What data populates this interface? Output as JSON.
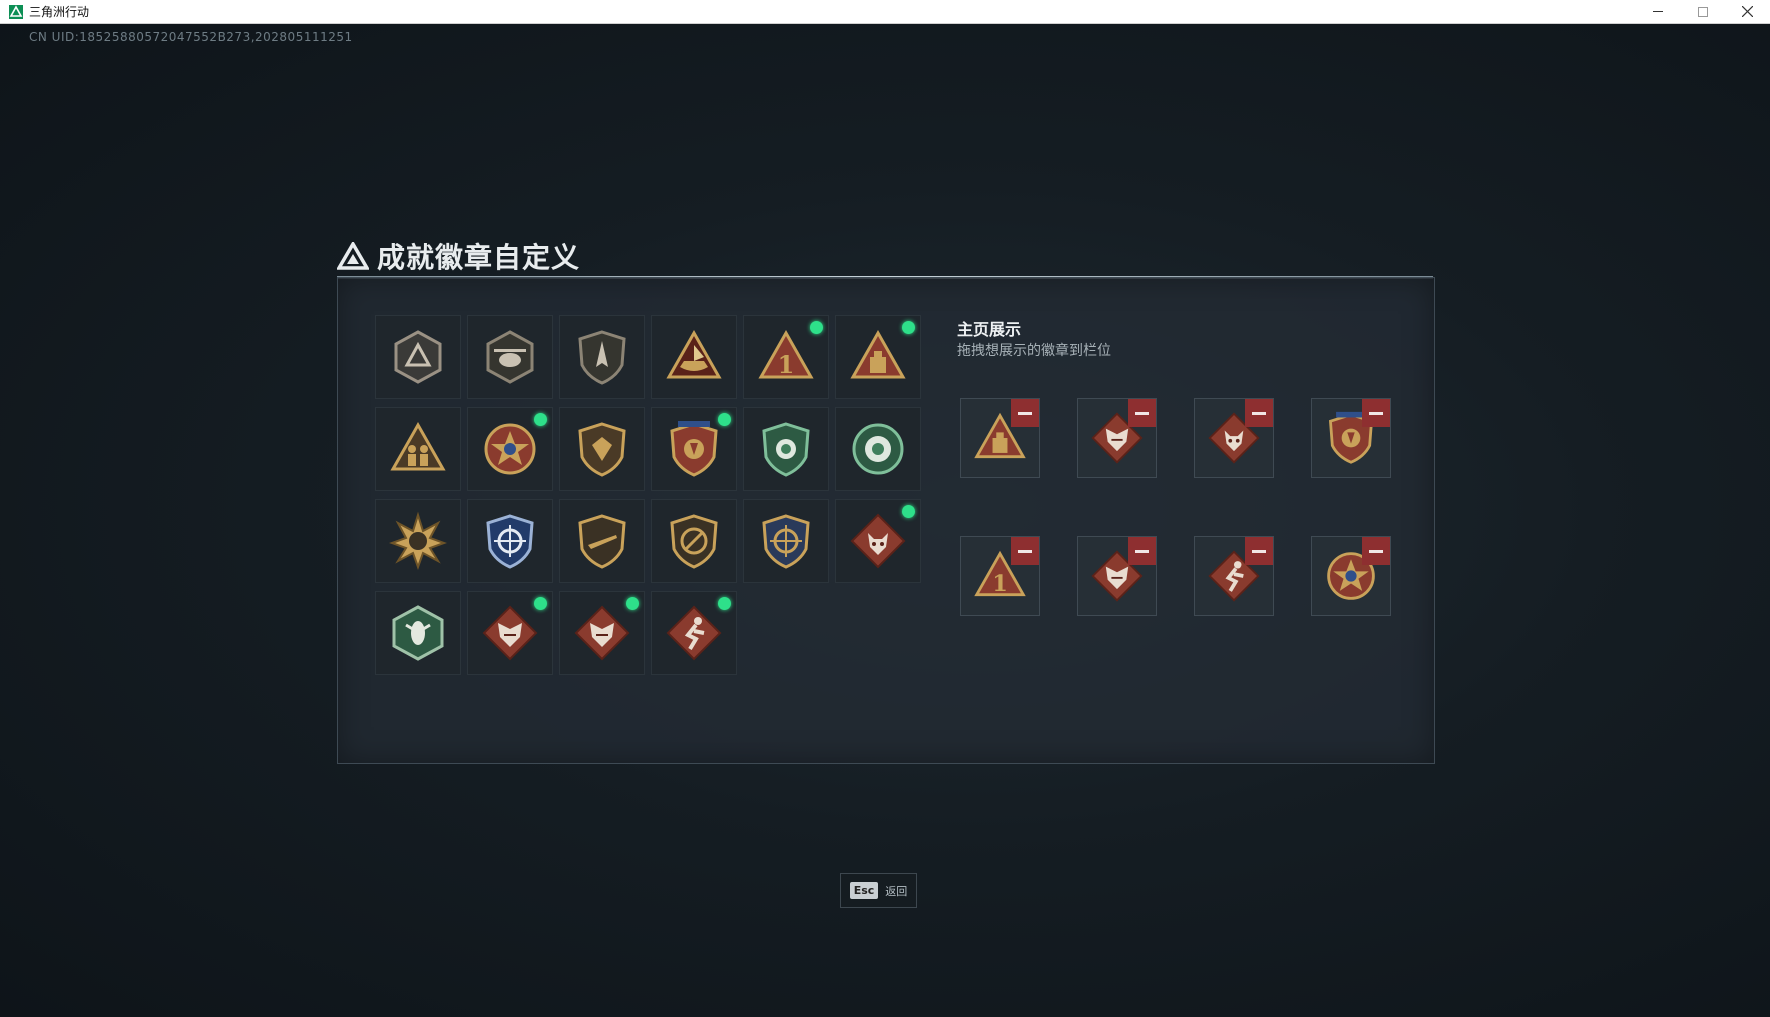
{
  "window": {
    "title": "三角洲行动",
    "icon": "delta-logo-icon"
  },
  "uid_text": "CN UID:18525880572047552B273,202805111251",
  "panel": {
    "title": "成就徽章自定义",
    "showcase_title": "主页展示",
    "showcase_hint": "拖拽想展示的徽章到栏位"
  },
  "badges": [
    {
      "icon": "delta-shield-badge-icon",
      "new": false
    },
    {
      "icon": "helicopter-badge-icon",
      "new": false
    },
    {
      "icon": "jet-shield-badge-icon",
      "new": false
    },
    {
      "icon": "ship-triangle-badge-icon",
      "new": false
    },
    {
      "icon": "number-one-triangle-badge-icon",
      "new": true
    },
    {
      "icon": "supply-crate-triangle-badge-icon",
      "new": true
    },
    {
      "icon": "soldiers-triangle-badge-icon",
      "new": false
    },
    {
      "icon": "star-medal-badge-icon",
      "new": true
    },
    {
      "icon": "shield-emblem-badge-icon",
      "new": false
    },
    {
      "icon": "winged-crest-badge-icon",
      "new": true
    },
    {
      "icon": "green-shield-badge-icon",
      "new": false
    },
    {
      "icon": "green-wreath-badge-icon",
      "new": false
    },
    {
      "icon": "sunburst-badge-icon",
      "new": false
    },
    {
      "icon": "blue-crosshair-crest-badge-icon",
      "new": false
    },
    {
      "icon": "rifle-shield-badge-icon",
      "new": false
    },
    {
      "icon": "no-weapon-shield-badge-icon",
      "new": false
    },
    {
      "icon": "golden-crosshair-crest-badge-icon",
      "new": false
    },
    {
      "icon": "wolf-diamond-badge-icon",
      "new": true
    },
    {
      "icon": "wasp-hexagon-badge-icon",
      "new": false
    },
    {
      "icon": "dragon-diamond-badge-icon",
      "new": true
    },
    {
      "icon": "dragon-diamond-badge-icon",
      "new": true
    },
    {
      "icon": "runner-diamond-badge-icon",
      "new": true
    }
  ],
  "showcase_slots": [
    {
      "icon": "supply-crate-triangle-badge-icon"
    },
    {
      "icon": "dragon-diamond-badge-icon"
    },
    {
      "icon": "wolf-diamond-badge-icon"
    },
    {
      "icon": "winged-crest-badge-icon"
    },
    {
      "icon": "number-one-triangle-badge-icon"
    },
    {
      "icon": "dragon-diamond-badge-icon"
    },
    {
      "icon": "runner-diamond-badge-icon"
    },
    {
      "icon": "star-medal-badge-icon"
    }
  ],
  "footer": {
    "esc_key": "Esc",
    "esc_label": "返回"
  },
  "colors": {
    "new_dot": "#2ee08a",
    "remove_button": "#8e2f30",
    "gold": "#c9a25a",
    "bronze_red": "#8a3b2e"
  }
}
